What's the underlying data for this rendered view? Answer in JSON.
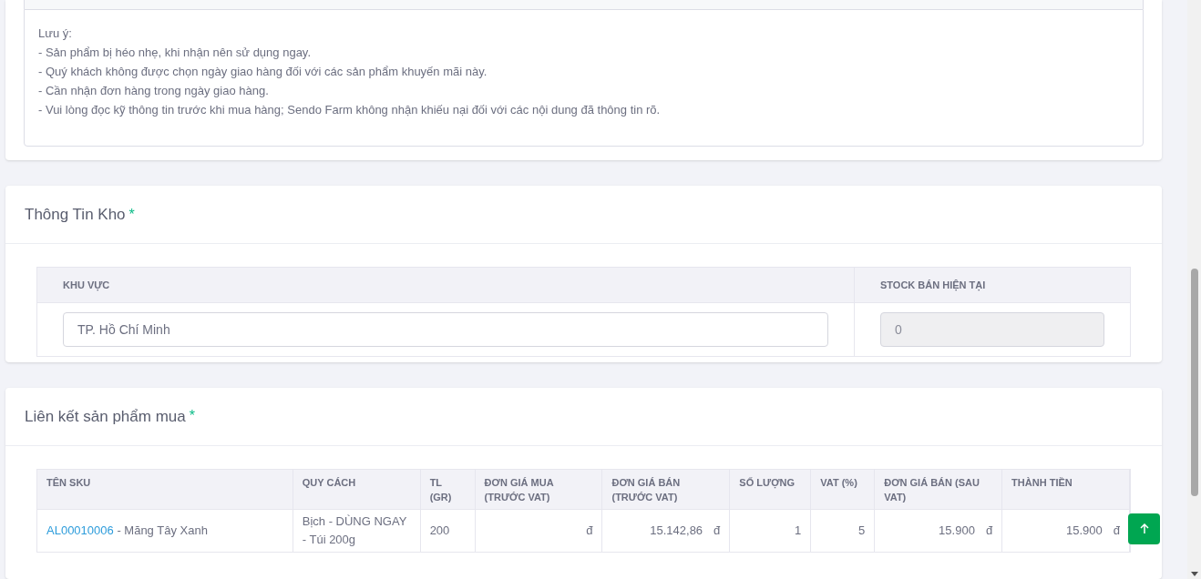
{
  "note": {
    "lines": [
      "Lưu ý:",
      "- Sản phẩm bị héo nhẹ, khi nhận nên sử dụng ngay.",
      "- Quý khách không được chọn ngày giao hàng đối với các sản phẩm khuyến mãi này.",
      "- Cần nhận đơn hàng trong ngày giao hàng.",
      "- Vui lòng đọc kỹ thông tin trước khi mua hàng; Sendo Farm không nhận khiếu nại đối với các nội dung đã thông tin rõ."
    ]
  },
  "warehouse": {
    "title": "Thông Tin Kho",
    "required_mark": "*",
    "columns": [
      "KHU VỰC",
      "STOCK BÁN HIỆN TẠI"
    ],
    "region": {
      "value": "TP. Hồ Chí Minh"
    },
    "stock": {
      "value": "0",
      "disabled": true
    }
  },
  "linked_products": {
    "title": "Liên kết sản phẩm mua",
    "required_mark": "*",
    "columns": [
      "TÊN SKU",
      "QUY CÁCH",
      "TL (GR)",
      "ĐƠN GIÁ MUA (TRƯỚC VAT)",
      "ĐƠN GIÁ BÁN (TRƯỚC VAT)",
      "SỐ LƯỢNG",
      "VAT (%)",
      "ĐƠN GIÁ BÁN (SAU VAT)",
      "THÀNH TIỀN"
    ],
    "rows": [
      {
        "cells": [
          {
            "kind": "sku",
            "code": "AL00010006",
            "name": "- Măng Tây Xanh"
          },
          {
            "kind": "text",
            "text": "Bịch - DÙNG NGAY - Túi 200g"
          },
          {
            "kind": "text",
            "text": "200"
          },
          {
            "kind": "money",
            "text": "",
            "currency": "đ"
          },
          {
            "kind": "money",
            "text": "15.142,86",
            "currency": "đ"
          },
          {
            "kind": "number",
            "text": "1"
          },
          {
            "kind": "number",
            "text": "5"
          },
          {
            "kind": "money",
            "text": "15.900",
            "currency": "đ"
          },
          {
            "kind": "money",
            "text": "15.900",
            "currency": "đ"
          }
        ]
      }
    ]
  }
}
